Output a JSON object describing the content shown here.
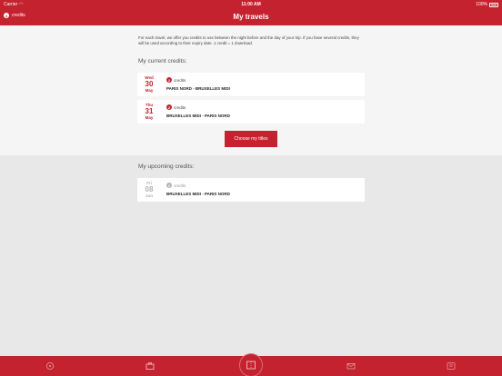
{
  "status_bar": {
    "carrier": "Carrier",
    "time": "11:00 AM",
    "battery": "100%"
  },
  "nav": {
    "back_count": "4",
    "back_label": "credits",
    "title": "My travels"
  },
  "intro_text": "For each travel, we offer you credits to use between the night before and the day of your trip. If you have several credits, they will be used according to their expiry date. 1 credit = 1 download.",
  "current": {
    "heading": "My current credits:",
    "items": [
      {
        "dow": "Wed",
        "day": "30",
        "month": "May",
        "count": "2",
        "credits_label": "credits",
        "route": "PARIS NORD - BRUXELLES MIDI"
      },
      {
        "dow": "Thu",
        "day": "31",
        "month": "May",
        "count": "2",
        "credits_label": "credits",
        "route": "BRUXELLES MIDI - PARIS NORD"
      }
    ]
  },
  "choose_button": "Choose my titles",
  "upcoming": {
    "heading": "My upcoming credits:",
    "items": [
      {
        "dow": "Fri",
        "day": "08",
        "month": "Jun",
        "count": "2",
        "credits_label": "credits",
        "route": "BRUXELLES MIDI - PARIS NORD"
      }
    ]
  },
  "colors": {
    "brand_red": "#c4222e",
    "muted_grey": "#b0b0b0"
  },
  "tab_icons": [
    "home-icon",
    "briefcase-icon",
    "ticket-icon",
    "mail-icon",
    "profile-icon"
  ]
}
